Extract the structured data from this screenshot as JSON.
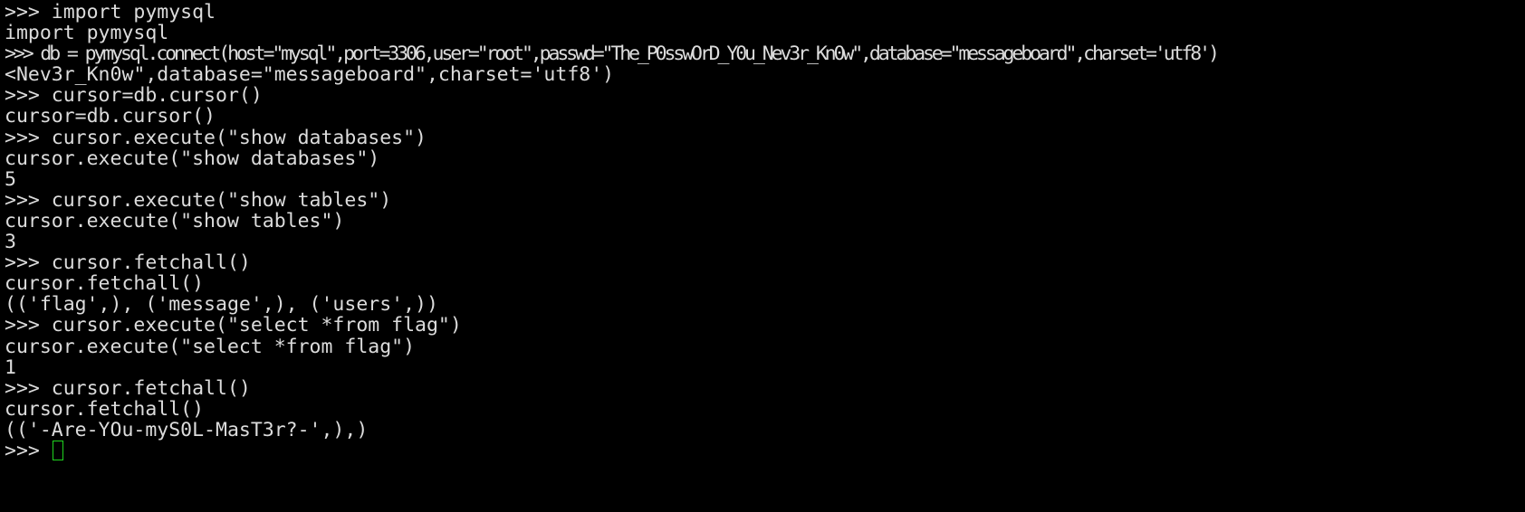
{
  "terminal": {
    "lines": [
      ">>> import pymysql",
      "import pymysql",
      ">>> db = pymysql.connect(host=\"mysql\",port=3306,user=\"root\",passwd=\"The_P0sswOrD_Y0u_Nev3r_Kn0w\",database=\"messageboard\",charset='utf8')",
      "<Nev3r_Kn0w\",database=\"messageboard\",charset='utf8')",
      ">>> cursor=db.cursor()",
      "cursor=db.cursor()",
      ">>> cursor.execute(\"show databases\")",
      "cursor.execute(\"show databases\")",
      "5",
      ">>> cursor.execute(\"show tables\")",
      "cursor.execute(\"show tables\")",
      "3",
      ">>> cursor.fetchall()",
      "cursor.fetchall()",
      "(('flag',), ('message',), ('users',))",
      ">>> cursor.execute(\"select *from flag\")",
      "cursor.execute(\"select *from flag\")",
      "1",
      ">>> cursor.fetchall()",
      "cursor.fetchall()",
      "(('-Are-YOu-myS0L-MasT3r?-',),)"
    ],
    "prompt": ">>> ",
    "cursor_color": "#1fd41f"
  }
}
